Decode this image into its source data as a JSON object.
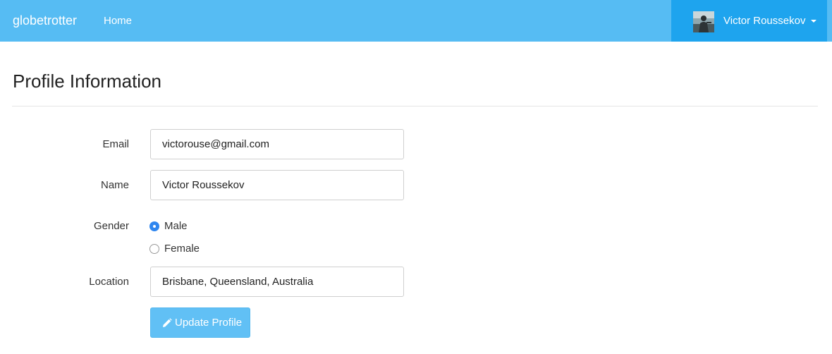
{
  "navbar": {
    "brand": "globetrotter",
    "home_label": "Home",
    "user": {
      "name": "Victor Roussekov",
      "avatar_icon": "user-avatar"
    },
    "colors": {
      "bar": "#56bcf3",
      "user_menu": "#1ea4ee"
    }
  },
  "page": {
    "title": "Profile Information"
  },
  "form": {
    "email": {
      "label": "Email",
      "value": "victorouse@gmail.com"
    },
    "name": {
      "label": "Name",
      "value": "Victor Roussekov"
    },
    "gender": {
      "label": "Gender",
      "options": [
        {
          "label": "Male",
          "checked": true
        },
        {
          "label": "Female",
          "checked": false
        }
      ]
    },
    "location": {
      "label": "Location",
      "value": "Brisbane, Queensland, Australia"
    },
    "submit": {
      "label": "Update Profile",
      "icon": "pencil-icon"
    }
  }
}
